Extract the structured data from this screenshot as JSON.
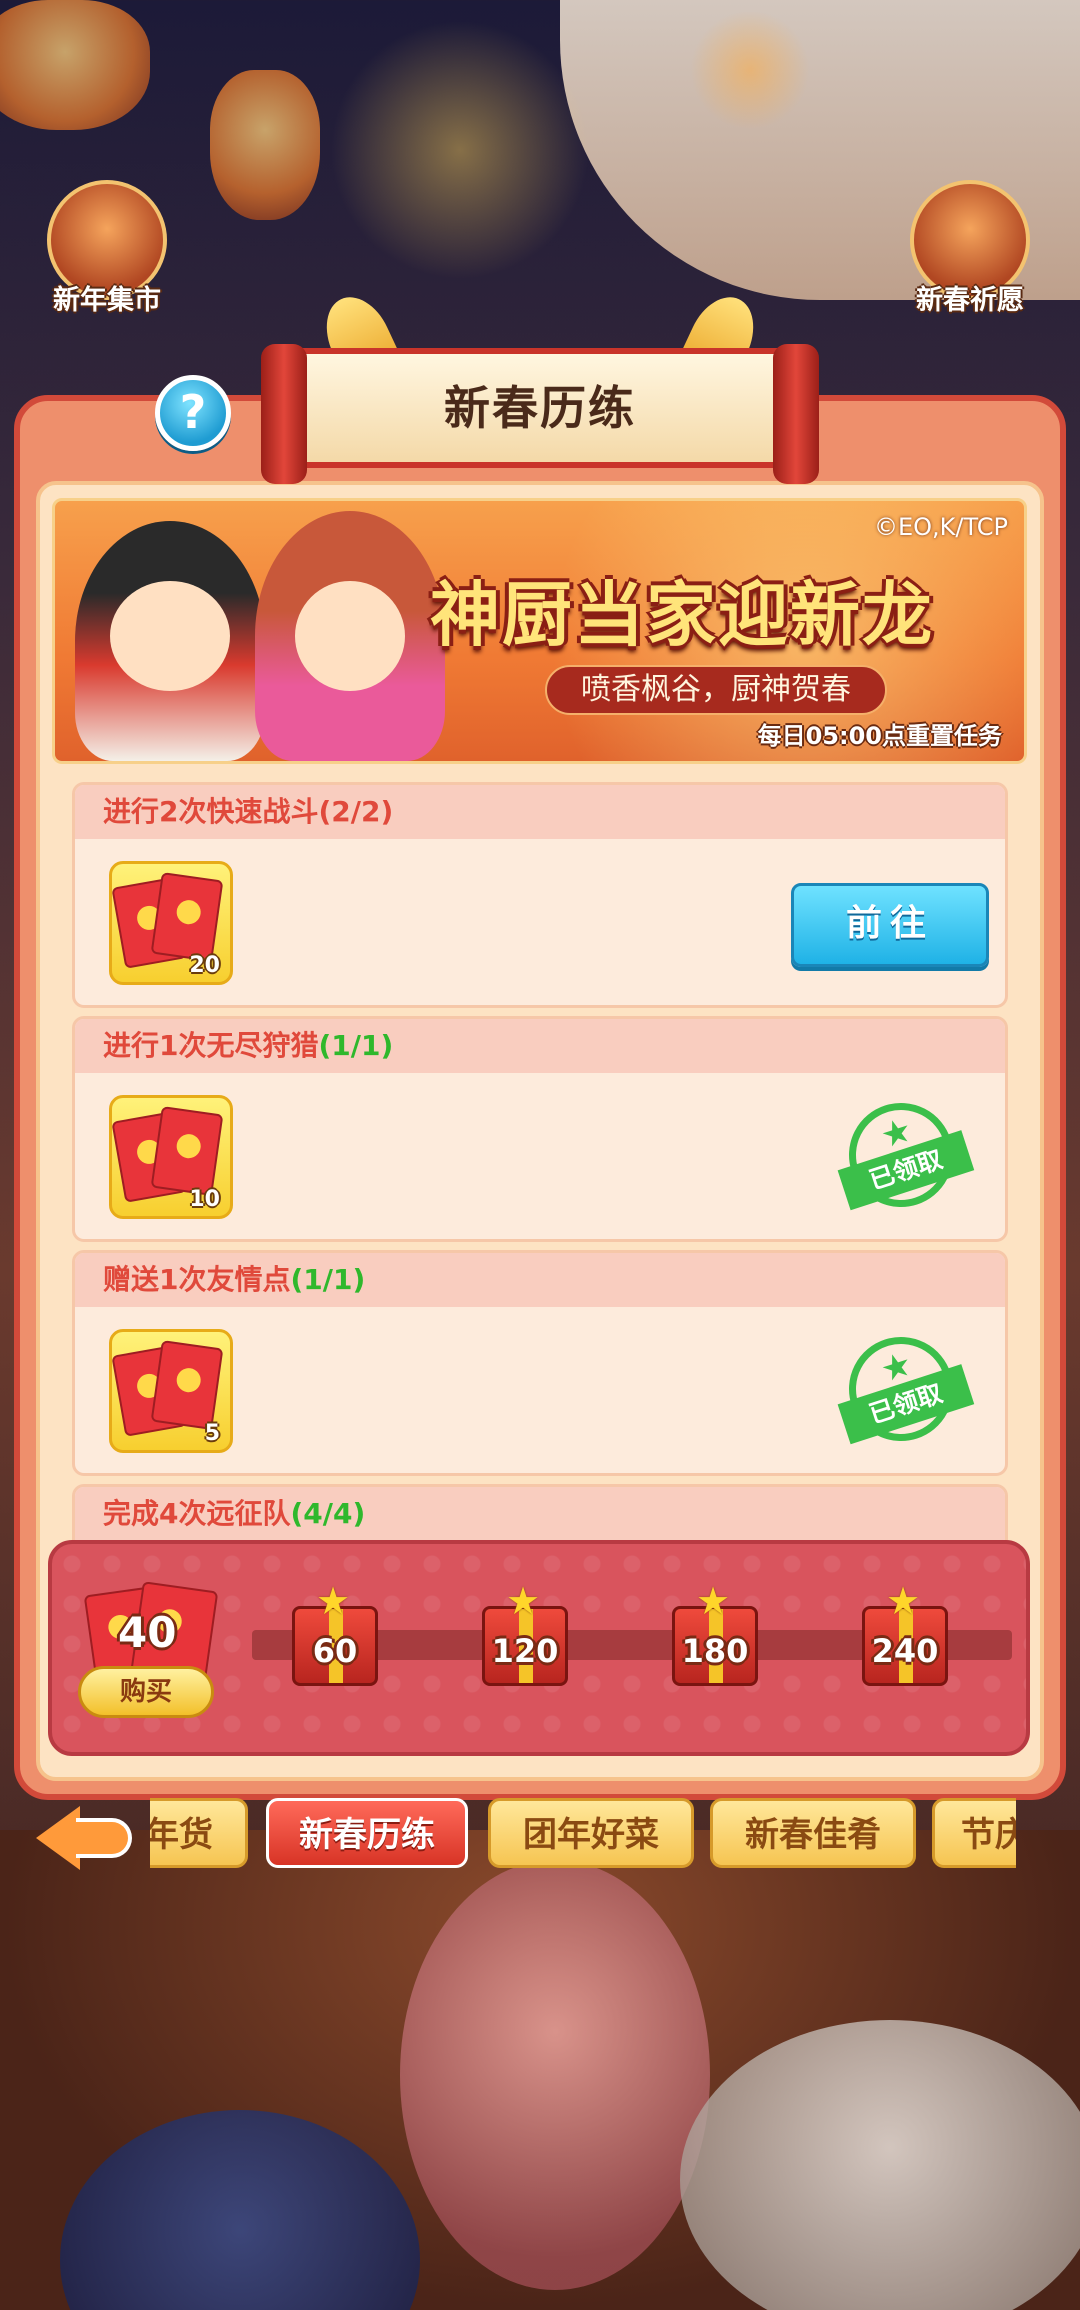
{
  "corner_buttons": {
    "left_label": "新年集市",
    "right_label": "新春祈愿"
  },
  "panel": {
    "title": "新春历练",
    "help_symbol": "?"
  },
  "banner": {
    "copyright": "©EO,K/TCP",
    "title": "神厨当家迎新龙",
    "subtitle": "喷香枫谷，厨神贺春",
    "reset_note": "每日05:00点重置任务"
  },
  "tasks": [
    {
      "name": "进行2次快速战斗",
      "progress": "(2/2)",
      "reward_count": "20",
      "status": "go",
      "action_label": "前往"
    },
    {
      "name": "进行1次无尽狩猎",
      "progress": "(1/1)",
      "reward_count": "10",
      "status": "claimed",
      "action_label": "已领取"
    },
    {
      "name": "赠送1次友情点",
      "progress": "(1/1)",
      "reward_count": "5",
      "status": "claimed",
      "action_label": "已领取"
    },
    {
      "name": "完成4次远征队",
      "progress": "(4/4)"
    }
  ],
  "progress": {
    "current": "40",
    "buy_label": "购买",
    "milestones": [
      "60",
      "120",
      "180",
      "240"
    ],
    "fill_fraction": 0.0
  },
  "tabs": [
    {
      "label": "年货",
      "active": false
    },
    {
      "label": "新春历练",
      "active": true
    },
    {
      "label": "团年好菜",
      "active": false
    },
    {
      "label": "新春佳肴",
      "active": false
    },
    {
      "label": "节庆",
      "active": false
    }
  ],
  "icons": {
    "back": "back-arrow-icon",
    "help": "question-icon",
    "reward": "red-envelope-icon",
    "milestone": "gift-box-icon",
    "claimed": "claimed-stamp-icon"
  },
  "colors": {
    "accent_red": "#e0493b",
    "complete_green": "#2fb82c",
    "go_button": "#1fb2e6"
  }
}
